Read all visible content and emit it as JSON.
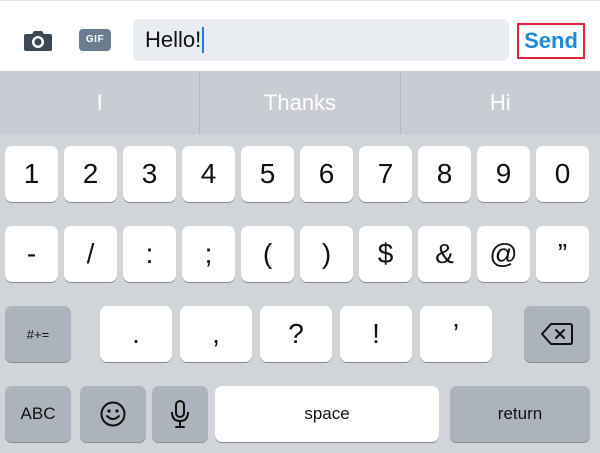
{
  "compose": {
    "message_text": "Hello!",
    "gif_label": "GIF",
    "send_label": "Send"
  },
  "suggestions": [
    "I",
    "Thanks",
    "Hi"
  ],
  "keyboard": {
    "row1": [
      "1",
      "2",
      "3",
      "4",
      "5",
      "6",
      "7",
      "8",
      "9",
      "0"
    ],
    "row2": [
      "-",
      "/",
      ":",
      ";",
      "(",
      ")",
      "$",
      "&",
      "@",
      "”"
    ],
    "row3": {
      "symbols_toggle": "#+=",
      "keys": [
        ".",
        ",",
        "?",
        "!",
        "’"
      ]
    },
    "row4": {
      "abc_label": "ABC",
      "space_label": "space",
      "return_label": "return"
    }
  },
  "colors": {
    "send_text": "#1e8ad9",
    "send_highlight": "#e0263c",
    "caret": "#1e7ee6"
  }
}
